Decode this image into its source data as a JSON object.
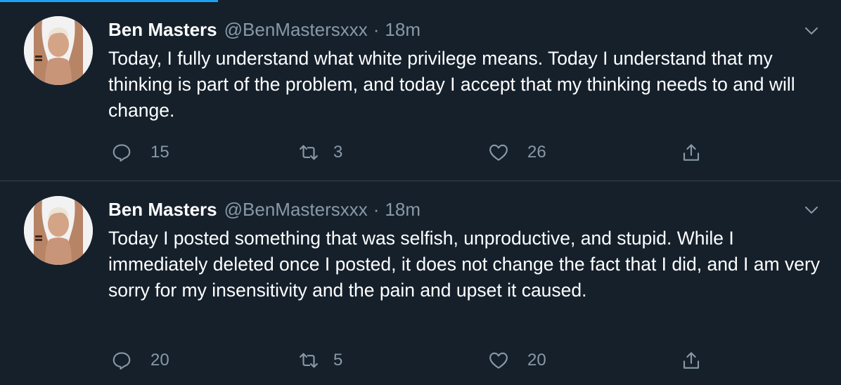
{
  "accent_color": "#1da1f2",
  "background_color": "#15202b",
  "tweets": [
    {
      "display_name": "Ben Masters",
      "handle": "@BenMastersxxx",
      "separator": "·",
      "time": "18m",
      "text": "Today, I fully understand what white privilege means.  Today I understand that my thinking is part of the problem, and today I accept that my thinking needs to and will change.",
      "replies": "15",
      "retweets": "3",
      "likes": "26"
    },
    {
      "display_name": "Ben Masters",
      "handle": "@BenMastersxxx",
      "separator": "·",
      "time": "18m",
      "text": "Today I posted something that was selfish, unproductive, and stupid.  While I immediately deleted once I posted, it does not change the fact that I did, and I am very sorry for my insensitivity and the pain and upset it caused.",
      "replies": "20",
      "retweets": "5",
      "likes": "20"
    }
  ],
  "icons": {
    "reply": "speech-bubble-icon",
    "retweet": "retweet-arrows-icon",
    "like": "heart-icon",
    "share": "share-arrow-icon",
    "more": "chevron-down-icon"
  }
}
